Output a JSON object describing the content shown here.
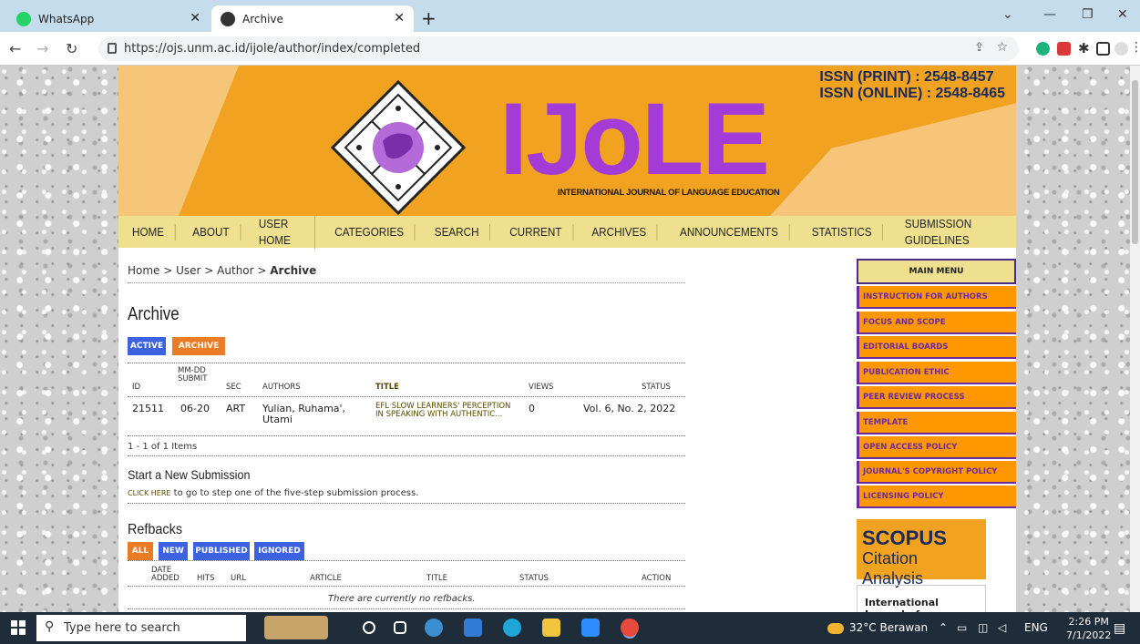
{
  "browser": {
    "tabs": [
      {
        "label": "WhatsApp",
        "icon": "whatsapp-icon"
      },
      {
        "label": "Archive",
        "icon": "globe-icon"
      }
    ],
    "url": "https://ojs.unm.ac.id/ijole/author/index/completed"
  },
  "banner": {
    "issn_print": "ISSN (PRINT)   : 2548-8457",
    "issn_online": "ISSN (ONLINE) : 2548-8465",
    "logo_text": "IJoLE",
    "logo_subtitle": "INTERNATIONAL JOURNAL OF LANGUAGE EDUCATION"
  },
  "nav": [
    "HOME",
    "ABOUT",
    "USER HOME",
    "CATEGORIES",
    "SEARCH",
    "CURRENT",
    "ARCHIVES",
    "ANNOUNCEMENTS",
    "STATISTICS",
    "SUBMISSION GUIDELINES"
  ],
  "breadcrumb": {
    "home": "Home",
    "user": "User",
    "author": "Author",
    "current": "Archive",
    "sep": " > "
  },
  "archive": {
    "heading": "Archive",
    "tab_active": "ACTIVE",
    "tab_archive": "ARCHIVE",
    "columns": {
      "id": "ID",
      "submit": "MM-DD SUBMIT",
      "sec": "SEC",
      "authors": "AUTHORS",
      "title": "TITLE",
      "views": "VIEWS",
      "status": "STATUS"
    },
    "rows": [
      {
        "id": "21511",
        "submit": "06-20",
        "sec": "ART",
        "authors": "Yulian, Ruhama', Utami",
        "title": "EFL SLOW LEARNERS' PERCEPTION IN SPEAKING WITH AUTHENTIC...",
        "views": "0",
        "status": "Vol. 6, No. 2, 2022"
      }
    ],
    "count": "1 - 1 of 1 Items"
  },
  "new_submission": {
    "heading": "Start a New Submission",
    "link": "CLICK HERE",
    "text": " to go to step one of the five-step submission process."
  },
  "refbacks": {
    "heading": "Refbacks",
    "filters": [
      "ALL",
      "NEW",
      "PUBLISHED",
      "IGNORED"
    ],
    "columns": {
      "date": "DATE ADDED",
      "hits": "HITS",
      "url": "URL",
      "article": "ARTICLE",
      "title": "TITLE",
      "status": "STATUS",
      "action": "ACTION"
    },
    "empty": "There are currently no refbacks."
  },
  "sidebar": {
    "menu_title": "MAIN MENU",
    "items": [
      "INSTRUCTION FOR AUTHORS",
      "FOCUS AND SCOPE",
      "EDITORIAL BOARDS",
      "PUBLICATION ETHIC",
      "PEER REVIEW PROCESS",
      "TEMPLATE",
      "OPEN ACCESS POLICY",
      "JOURNAL'S COPYRIGHT POLICY",
      "LICENSING POLICY"
    ],
    "scopus_title": "SCOPUS",
    "scopus_sub": "Citation Analysis",
    "journal_box": "International Journal of"
  },
  "taskbar": {
    "search_placeholder": "Type here to search",
    "weather": "32°C  Berawan",
    "lang": "ENG",
    "time": "2:26 PM",
    "date": "7/1/2022"
  },
  "colors": {
    "banner": "#f2a221",
    "logo": "#a43bd6",
    "nav": "#efe08f",
    "menu_item": "#ff9800",
    "btn_blue": "#3c62e0",
    "btn_orange": "#eb7c26"
  }
}
